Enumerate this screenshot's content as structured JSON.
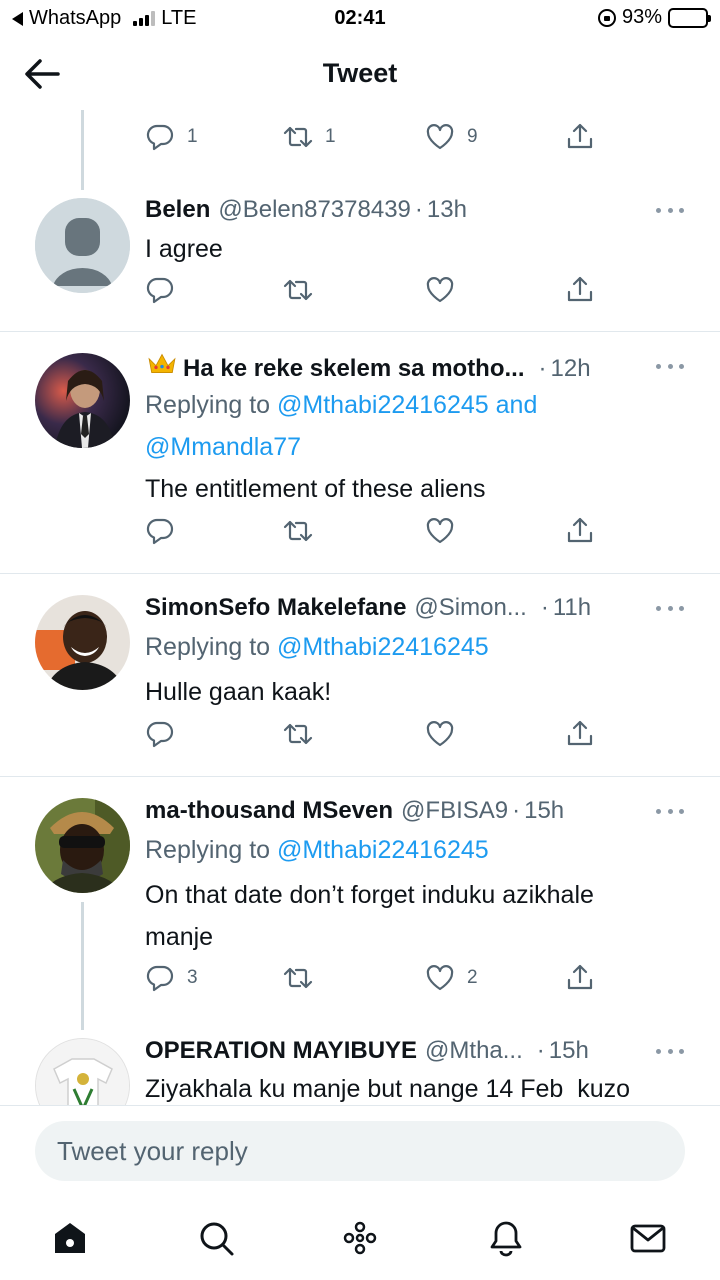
{
  "status_bar": {
    "back_app": "WhatsApp",
    "network": "LTE",
    "time": "02:41",
    "battery": "93%",
    "battery_level": 0.93
  },
  "header": {
    "title": "Tweet"
  },
  "top_actions": {
    "replies": "1",
    "retweets": "1",
    "likes": "9"
  },
  "replies": [
    {
      "name": "Belen",
      "handle": "@Belen87378439",
      "sep": "·",
      "time": "13h",
      "text": "I agree",
      "replies": "",
      "retweets": "",
      "likes": ""
    },
    {
      "name": "Ha ke reke skelem sa motho...",
      "handle": "",
      "sep": "·",
      "time": "12h",
      "replying_prefix": "Replying to",
      "mention1": "@Mthabi22416245",
      "and": "and",
      "mention2": "@Mmandla77",
      "text": "The entitlement of these aliens"
    },
    {
      "name": "SimonSefo Makelefane",
      "handle": "@Simon...",
      "sep": "·",
      "time": "11h",
      "replying_prefix": "Replying to",
      "mention1": "@Mthabi22416245",
      "text": "Hulle gaan kaak!"
    },
    {
      "name": "ma-thousand MSeven",
      "handle": "@FBISA9",
      "sep": "·",
      "time": "15h",
      "replying_prefix": "Replying to",
      "mention1": "@Mthabi22416245",
      "text_line1": "On that date don’t forget induku azikhale",
      "text_line2": "manje",
      "replies": "3",
      "likes": "2"
    },
    {
      "name": "OPERATION MAYIBUYE",
      "handle": "@Mtha...",
      "sep": "·",
      "time": "15h",
      "text": "Ziyakhala ku manje but nange 14 Feb  kuzo"
    }
  ],
  "reply_box": {
    "placeholder": "Tweet your reply"
  },
  "icons": {
    "crown": "crown-emoji",
    "home": "home-icon",
    "search": "search-icon",
    "spaces": "spaces-icon",
    "notifications": "bell-icon",
    "messages": "mail-icon"
  },
  "colors": {
    "accent": "#1d9bf0",
    "muted": "#536471",
    "text": "#0f1419"
  }
}
